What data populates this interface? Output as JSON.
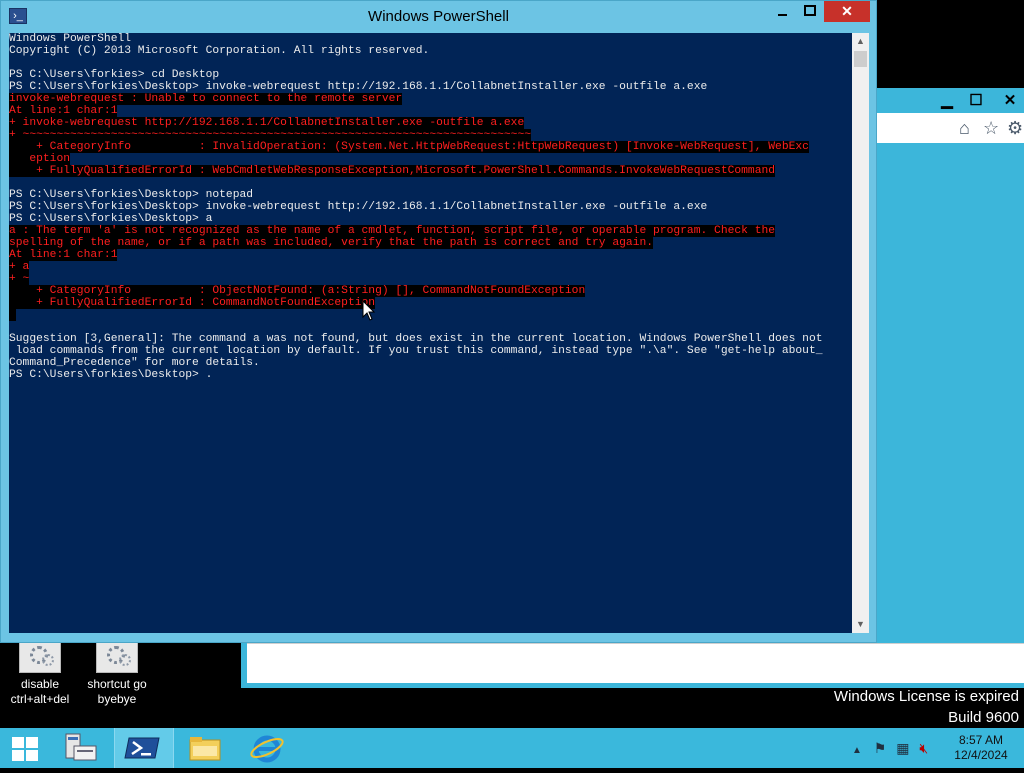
{
  "window": {
    "title": "Windows PowerShell"
  },
  "console": {
    "lines": [
      {
        "text": "Windows PowerShell",
        "type": "out"
      },
      {
        "text": "Copyright (C) 2013 Microsoft Corporation. All rights reserved.",
        "type": "out"
      },
      {
        "text": "",
        "type": "out"
      },
      {
        "text": "PS C:\\Users\\forkies> cd Desktop",
        "type": "out"
      },
      {
        "text": "PS C:\\Users\\forkies\\Desktop> invoke-webrequest http://192.168.1.1/CollabnetInstaller.exe -outfile a.exe",
        "type": "out"
      },
      {
        "text": "invoke-webrequest : Unable to connect to the remote server",
        "type": "err"
      },
      {
        "text": "At line:1 char:1",
        "type": "err"
      },
      {
        "text": "+ invoke-webrequest http://192.168.1.1/CollabnetInstaller.exe -outfile a.exe",
        "type": "err"
      },
      {
        "text": "+ ~~~~~~~~~~~~~~~~~~~~~~~~~~~~~~~~~~~~~~~~~~~~~~~~~~~~~~~~~~~~~~~~~~~~~~~~~~~",
        "type": "err"
      },
      {
        "text": "    + CategoryInfo          : InvalidOperation: (System.Net.HttpWebRequest:HttpWebRequest) [Invoke-WebRequest], WebExc",
        "type": "err"
      },
      {
        "text": "   eption",
        "type": "err"
      },
      {
        "text": "    + FullyQualifiedErrorId : WebCmdletWebResponseException,Microsoft.PowerShell.Commands.InvokeWebRequestCommand",
        "type": "err"
      },
      {
        "text": "",
        "type": "out"
      },
      {
        "text": "PS C:\\Users\\forkies\\Desktop> notepad",
        "type": "out"
      },
      {
        "text": "PS C:\\Users\\forkies\\Desktop> invoke-webrequest http://192.168.1.1/CollabnetInstaller.exe -outfile a.exe",
        "type": "out"
      },
      {
        "text": "PS C:\\Users\\forkies\\Desktop> a",
        "type": "out"
      },
      {
        "text": "a : The term 'a' is not recognized as the name of a cmdlet, function, script file, or operable program. Check the",
        "type": "err"
      },
      {
        "text": "spelling of the name, or if a path was included, verify that the path is correct and try again.",
        "type": "err"
      },
      {
        "text": "At line:1 char:1",
        "type": "err"
      },
      {
        "text": "+ a",
        "type": "err"
      },
      {
        "text": "+ ~",
        "type": "err"
      },
      {
        "text": "    + CategoryInfo          : ObjectNotFound: (a:String) [], CommandNotFoundException",
        "type": "err"
      },
      {
        "text": "    + FullyQualifiedErrorId : CommandNotFoundException",
        "type": "err"
      },
      {
        "text": " ",
        "type": "err"
      },
      {
        "text": "",
        "type": "out"
      },
      {
        "text": "Suggestion [3,General]: The command a was not found, but does exist in the current location. Windows PowerShell does not",
        "type": "out"
      },
      {
        "text": " load commands from the current location by default. If you trust this command, instead type \".\\a\". See \"get-help about_",
        "type": "out"
      },
      {
        "text": "Command_Precedence\" for more details.",
        "type": "out"
      },
      {
        "text": "PS C:\\Users\\forkies\\Desktop> .",
        "type": "out"
      }
    ]
  },
  "desktop": {
    "icons": [
      {
        "label": "disable ctrl+alt+del",
        "icon": "settings-gear-icon"
      },
      {
        "label": "shortcut go byebye",
        "icon": "settings-gear-icon"
      }
    ],
    "watermark": {
      "line1": "Windows License is expired",
      "line2": "Build 9600"
    }
  },
  "taskbar": {
    "items": [
      "start-icon",
      "server-manager-icon",
      "powershell-icon",
      "file-explorer-icon",
      "internet-explorer-icon"
    ],
    "clock": {
      "time": "8:57 AM",
      "date": "12/4/2024"
    }
  },
  "colors": {
    "console_bg": "#012456",
    "console_fg": "#ececec",
    "error_fg": "#ff1f1f",
    "taskbar_bg": "#3ab8dc",
    "title_bg": "#6cc4e4"
  }
}
